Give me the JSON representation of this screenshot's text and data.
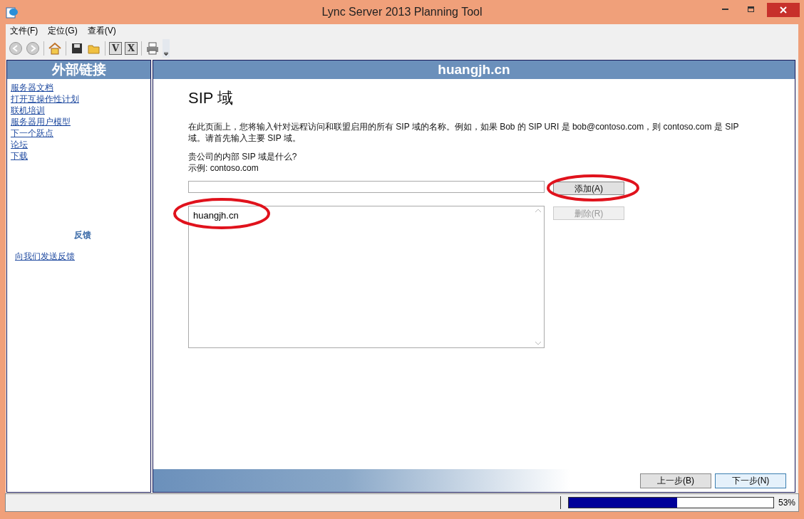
{
  "window": {
    "title": "Lync Server 2013 Planning Tool"
  },
  "menu": [
    "文件(F)",
    "定位(G)",
    "查看(V)"
  ],
  "toolbar": [
    {
      "kind": "back"
    },
    {
      "kind": "forward"
    },
    {
      "kind": "sep"
    },
    {
      "kind": "home"
    },
    {
      "kind": "sep"
    },
    {
      "kind": "save"
    },
    {
      "kind": "open"
    },
    {
      "kind": "sep"
    },
    {
      "kind": "letter",
      "glyph": "V"
    },
    {
      "kind": "letter",
      "glyph": "X"
    },
    {
      "kind": "sep"
    },
    {
      "kind": "print"
    },
    {
      "kind": "overflow"
    }
  ],
  "sidebar": {
    "title": "外部链接",
    "links": [
      "服务器文档",
      "打开互操作性计划",
      "联机培训",
      "服务器用户模型",
      "下一个跃点",
      "论坛",
      "下载"
    ],
    "feedback_title": "反馈",
    "feedback_link": "向我们发送反馈"
  },
  "main": {
    "header": "huangjh.cn",
    "heading": "SIP 域",
    "description": "在此页面上，您将输入针对远程访问和联盟启用的所有 SIP 域的名称。例如，如果 Bob 的 SIP URI 是 bob@contoso.com，则 contoso.com 是 SIP 域。请首先输入主要 SIP 域。",
    "question": "贵公司的内部 SIP 域是什么?",
    "example": "示例: contoso.com",
    "add_button": {
      "label": "添加(A)",
      "disabled": false
    },
    "remove_button": {
      "label": "删除(R)",
      "disabled": true
    },
    "domains": [
      "huangjh.cn"
    ]
  },
  "nav": [
    {
      "label": "上一步(B)",
      "focused": false
    },
    {
      "label": "下一步(N)",
      "focused": true
    }
  ],
  "status_bar": {
    "level": 0.53,
    "reading": "53%"
  }
}
